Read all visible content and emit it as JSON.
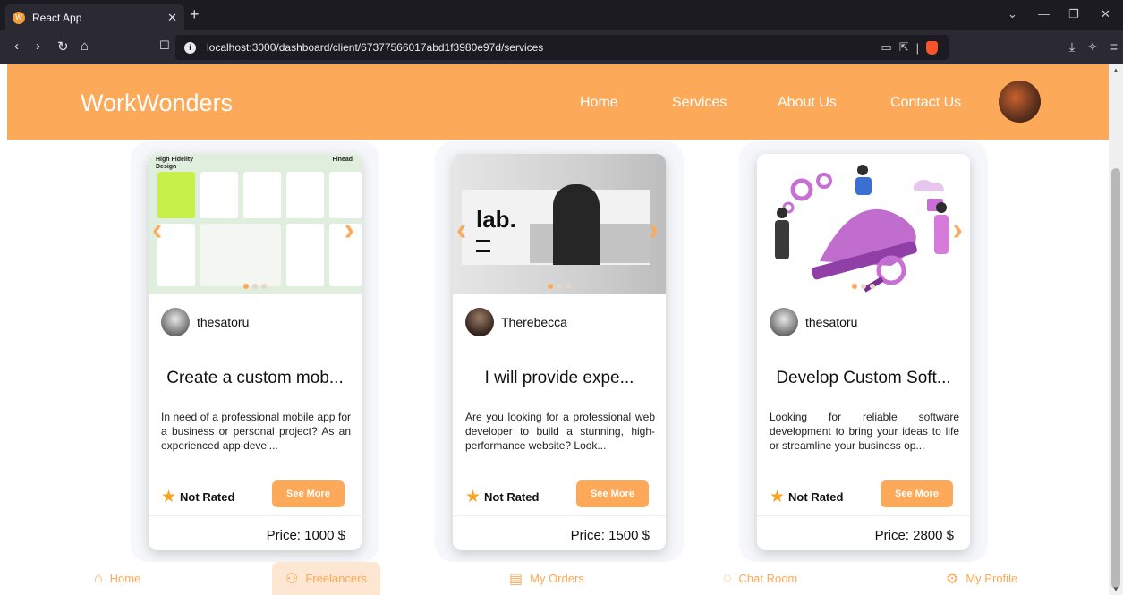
{
  "browser": {
    "tab_title": "React App",
    "url": "localhost:3000/dashboard/client/67377566017abd1f3980e97d/services"
  },
  "header": {
    "brand": "WorkWonders",
    "menu": [
      "Home",
      "Services",
      "About Us",
      "Contact Us"
    ]
  },
  "cards": [
    {
      "user": "thesatoru",
      "title": "Create a custom mob...",
      "description": "In need of a professional mobile app for a business or personal project? As an experienced app devel...",
      "rating": "Not Rated",
      "button": "See More",
      "price": "Price: 1000 $",
      "media_heading": "High Fidelity Design",
      "media_brand": "Finead"
    },
    {
      "user": "Therebecca",
      "title": "I will provide expe...",
      "description": "Are you looking for a professional web developer to build a stunning, high-performance website? Look...",
      "rating": "Not Rated",
      "button": "See More",
      "price": "Price: 1500 $",
      "media_logo": "lab."
    },
    {
      "user": "thesatoru",
      "title": "Develop Custom Soft...",
      "description": "Looking for reliable software development to bring your ideas to life or streamline your business op...",
      "rating": "Not Rated",
      "button": "See More",
      "price": "Price: 2800 $"
    }
  ],
  "bottom_nav": [
    "Home",
    "Freelancers",
    "My Orders",
    "Chat Room",
    "My Profile"
  ],
  "colors": {
    "accent": "#fca95a",
    "star": "#fca21e"
  }
}
